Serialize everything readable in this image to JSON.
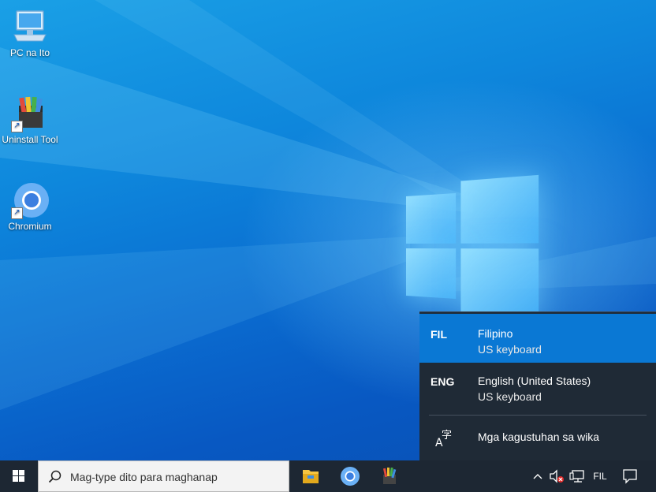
{
  "desktop": {
    "icons": [
      {
        "label": "PC na Ito",
        "icon": "computer-icon"
      },
      {
        "label": "Uninstall Tool",
        "icon": "uninstall-tool-icon"
      },
      {
        "label": "Chromium",
        "icon": "chromium-icon"
      }
    ]
  },
  "language_flyout": {
    "items": [
      {
        "code": "FIL",
        "name": "Filipino",
        "keyboard": "US keyboard",
        "selected": true
      },
      {
        "code": "ENG",
        "name": "English (United States)",
        "keyboard": "US keyboard",
        "selected": false
      }
    ],
    "preferences_label": "Mga kagustuhan sa wika",
    "preferences_icon": "language-settings-icon"
  },
  "taskbar": {
    "search_placeholder": "Mag-type dito para maghanap",
    "pinned_apps": [
      "file-explorer-icon",
      "chromium-icon",
      "uninstall-tool-icon"
    ],
    "tray": {
      "language_indicator": "FIL",
      "icons": [
        "show-hidden-icons-chevron",
        "volume-muted-icon",
        "network-icon",
        "notification-center-icon"
      ]
    }
  },
  "colors": {
    "flyout_bg": "#1f2a36",
    "flyout_selected": "#0a78d4",
    "taskbar_bg": "#1d2733"
  }
}
